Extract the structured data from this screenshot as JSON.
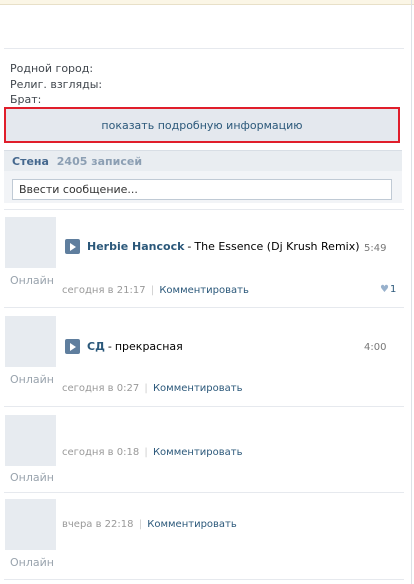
{
  "profile_info": {
    "hometown_label": "Родной город:",
    "religion_label": "Религ. взгляды:",
    "brother_label": "Брат:"
  },
  "show_more_label": "показать подробную информацию",
  "wall": {
    "title": "Стена",
    "count": "2405 записей",
    "input_placeholder": "Ввести сообщение..."
  },
  "posts": [
    {
      "online": "Онлайн",
      "audio": {
        "artist": "Herbie Hancock",
        "dash": "-",
        "title": "The Essence (Dj Krush Remix)",
        "duration": "5:49"
      },
      "time": "сегодня в 21:17",
      "separator": "|",
      "comment_label": "Комментировать",
      "likes": "1"
    },
    {
      "online": "Онлайн",
      "audio": {
        "artist": "СД",
        "dash": "-",
        "title": "прекрасная",
        "duration": "4:00"
      },
      "time": "сегодня в 0:27",
      "separator": "|",
      "comment_label": "Комментировать"
    },
    {
      "online": "Онлайн",
      "time": "сегодня в 0:18",
      "separator": "|",
      "comment_label": "Комментировать"
    },
    {
      "online": "Онлайн",
      "time": "вчера в 22:18",
      "separator": "|",
      "comment_label": "Комментировать"
    }
  ],
  "colors": {
    "link": "#2b587a",
    "highlight_border": "#e01e2b",
    "wall_header_bg": "#e9edf1",
    "button_bg": "#e4e8ee"
  },
  "icons": {
    "play": "play-icon",
    "like": "heart-icon"
  }
}
